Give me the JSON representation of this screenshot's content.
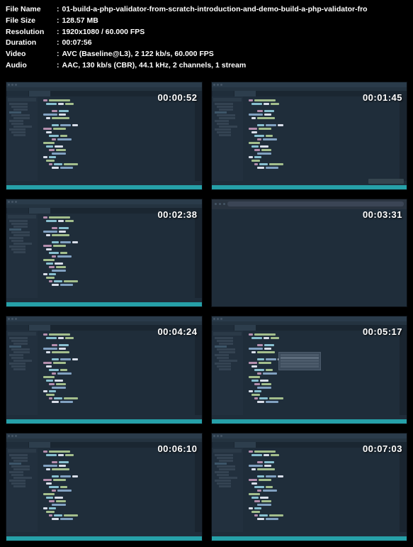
{
  "metadata": {
    "file_name_label": "File Name",
    "file_name_value": "01-build-a-php-validator-from-scratch-introduction-and-demo-build-a-php-validator-fro",
    "file_size_label": "File Size",
    "file_size_value": "128.57 MB",
    "resolution_label": "Resolution",
    "resolution_value": "1920x1080 / 60.000 FPS",
    "duration_label": "Duration",
    "duration_value": "00:07:56",
    "video_label": "Video",
    "video_value": "AVC (Baseline@L3), 2 122 kb/s, 60.000 FPS",
    "audio_label": "Audio",
    "audio_value": "AAC, 130 kb/s (CBR), 44.1 kHz, 2 channels, 1 stream"
  },
  "thumbnails": [
    {
      "timestamp": "00:00:52",
      "type": "editor"
    },
    {
      "timestamp": "00:01:45",
      "type": "editor_button"
    },
    {
      "timestamp": "00:02:38",
      "type": "editor"
    },
    {
      "timestamp": "00:03:31",
      "type": "browser"
    },
    {
      "timestamp": "00:04:24",
      "type": "editor"
    },
    {
      "timestamp": "00:05:17",
      "type": "editor_popup"
    },
    {
      "timestamp": "00:06:10",
      "type": "editor"
    },
    {
      "timestamp": "00:07:03",
      "type": "editor"
    }
  ]
}
